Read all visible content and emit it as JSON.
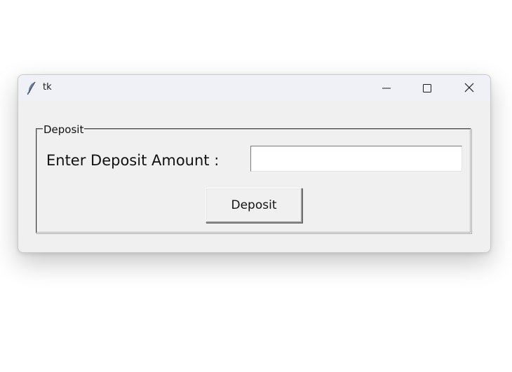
{
  "window": {
    "title": "tk",
    "icon": "feather-icon",
    "controls": {
      "minimize": "minimize-icon",
      "maximize": "maximize-icon",
      "close": "close-icon"
    }
  },
  "deposit_frame": {
    "legend": "Deposit",
    "amount_label": "Enter Deposit Amount :",
    "amount_value": "",
    "amount_placeholder": "",
    "button_label": "Deposit"
  },
  "colors": {
    "window_bg": "#f0f0f0",
    "titlebar_bg": "#eff1f6",
    "entry_bg": "#ffffff"
  }
}
